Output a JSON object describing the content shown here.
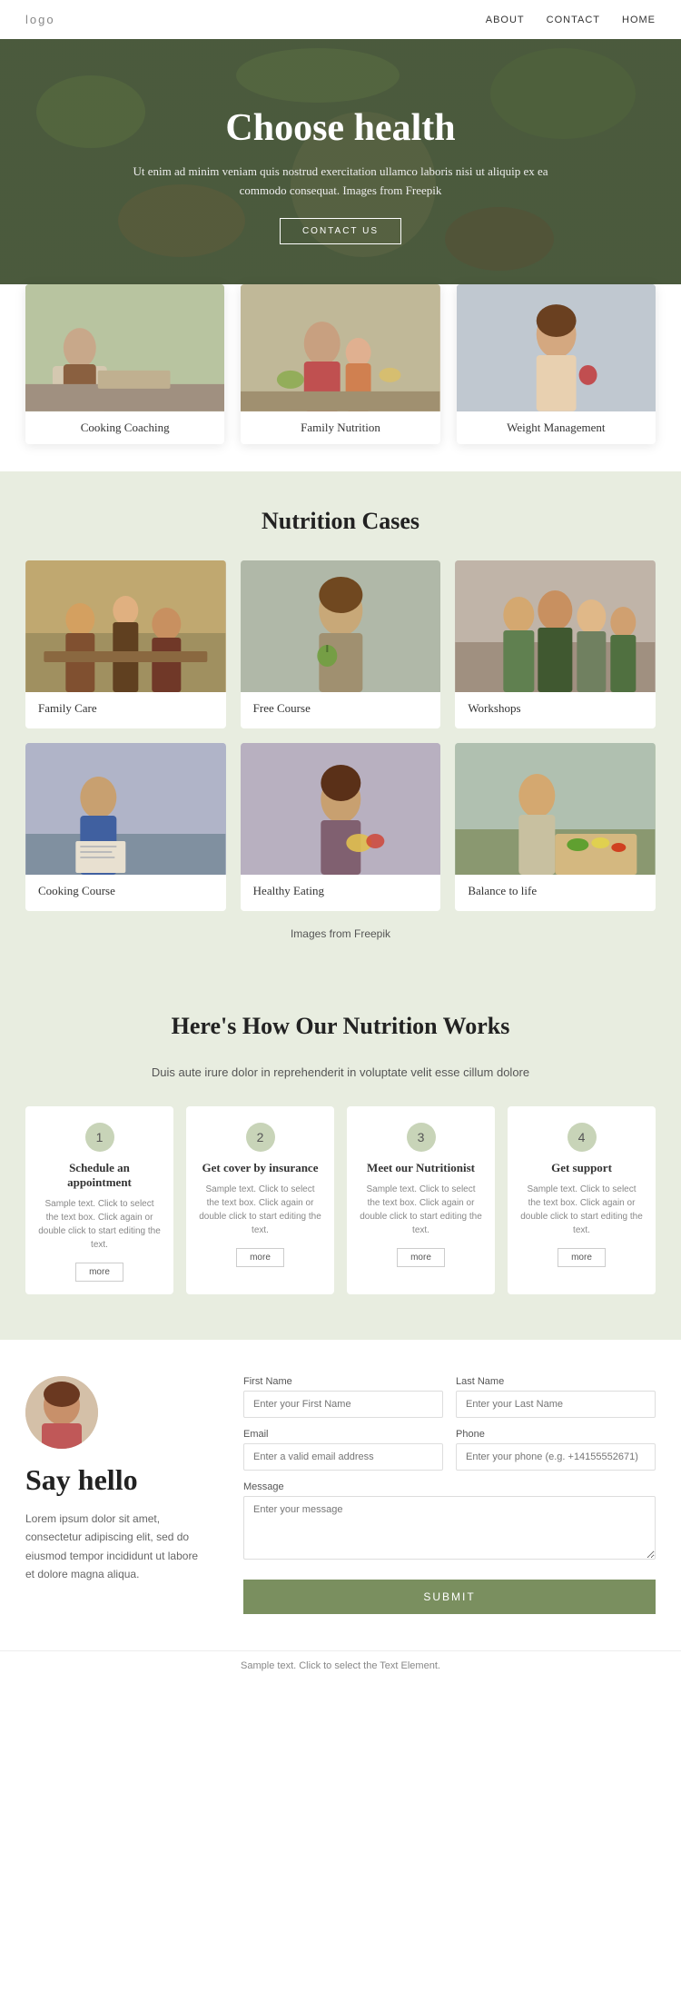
{
  "nav": {
    "logo": "logo",
    "links": [
      "ABOUT",
      "CONTACT",
      "HOME"
    ]
  },
  "hero": {
    "title": "Choose health",
    "description": "Ut enim ad minim veniam quis nostrud exercitation ullamco laboris nisi ut aliquip ex ea commodo consequat. Images from",
    "freepik_link": "Freepik",
    "btn_label": "CONTACT US"
  },
  "top_cards": [
    {
      "label": "Cooking Coaching"
    },
    {
      "label": "Family Nutrition"
    },
    {
      "label": "Weight Management"
    }
  ],
  "nutrition_section": {
    "title": "Nutrition Cases",
    "cards": [
      {
        "label": "Family Care"
      },
      {
        "label": "Free Course"
      },
      {
        "label": "Workshops"
      },
      {
        "label": "Cooking Course"
      },
      {
        "label": "Healthy Eating"
      },
      {
        "label": "Balance to life"
      }
    ],
    "freepik_text": "Images from",
    "freepik_link": "Freepik"
  },
  "how_section": {
    "title": "Here's How Our Nutrition Works",
    "subtitle": "Duis aute irure dolor in reprehenderit in voluptate velit esse cillum dolore",
    "steps": [
      {
        "num": "1",
        "title": "Schedule an appointment",
        "text": "Sample text. Click to select the text box. Click again or double click to start editing the text.",
        "more": "more"
      },
      {
        "num": "2",
        "title": "Get cover by insurance",
        "text": "Sample text. Click to select the text box. Click again or double click to start editing the text.",
        "more": "more"
      },
      {
        "num": "3",
        "title": "Meet our Nutritionist",
        "text": "Sample text. Click to select the text box. Click again or double click to start editing the text.",
        "more": "more"
      },
      {
        "num": "4",
        "title": "Get support",
        "text": "Sample text. Click to select the text box. Click again or double click to start editing the text.",
        "more": "more"
      }
    ]
  },
  "hello_section": {
    "heading": "Say hello",
    "body": "Lorem ipsum dolor sit amet, consectetur adipiscing elit, sed do eiusmod tempor incididunt ut labore et dolore magna aliqua.",
    "form": {
      "first_name_label": "First Name",
      "first_name_placeholder": "Enter your First Name",
      "last_name_label": "Last Name",
      "last_name_placeholder": "Enter your Last Name",
      "email_label": "Email",
      "email_placeholder": "Enter a valid email address",
      "phone_label": "Phone",
      "phone_placeholder": "Enter your phone (e.g. +14155552671)",
      "message_label": "Message",
      "message_placeholder": "Enter your message",
      "submit_label": "SUBMIT"
    }
  },
  "footer": {
    "note": "Sample text. Click to select the Text Element."
  }
}
